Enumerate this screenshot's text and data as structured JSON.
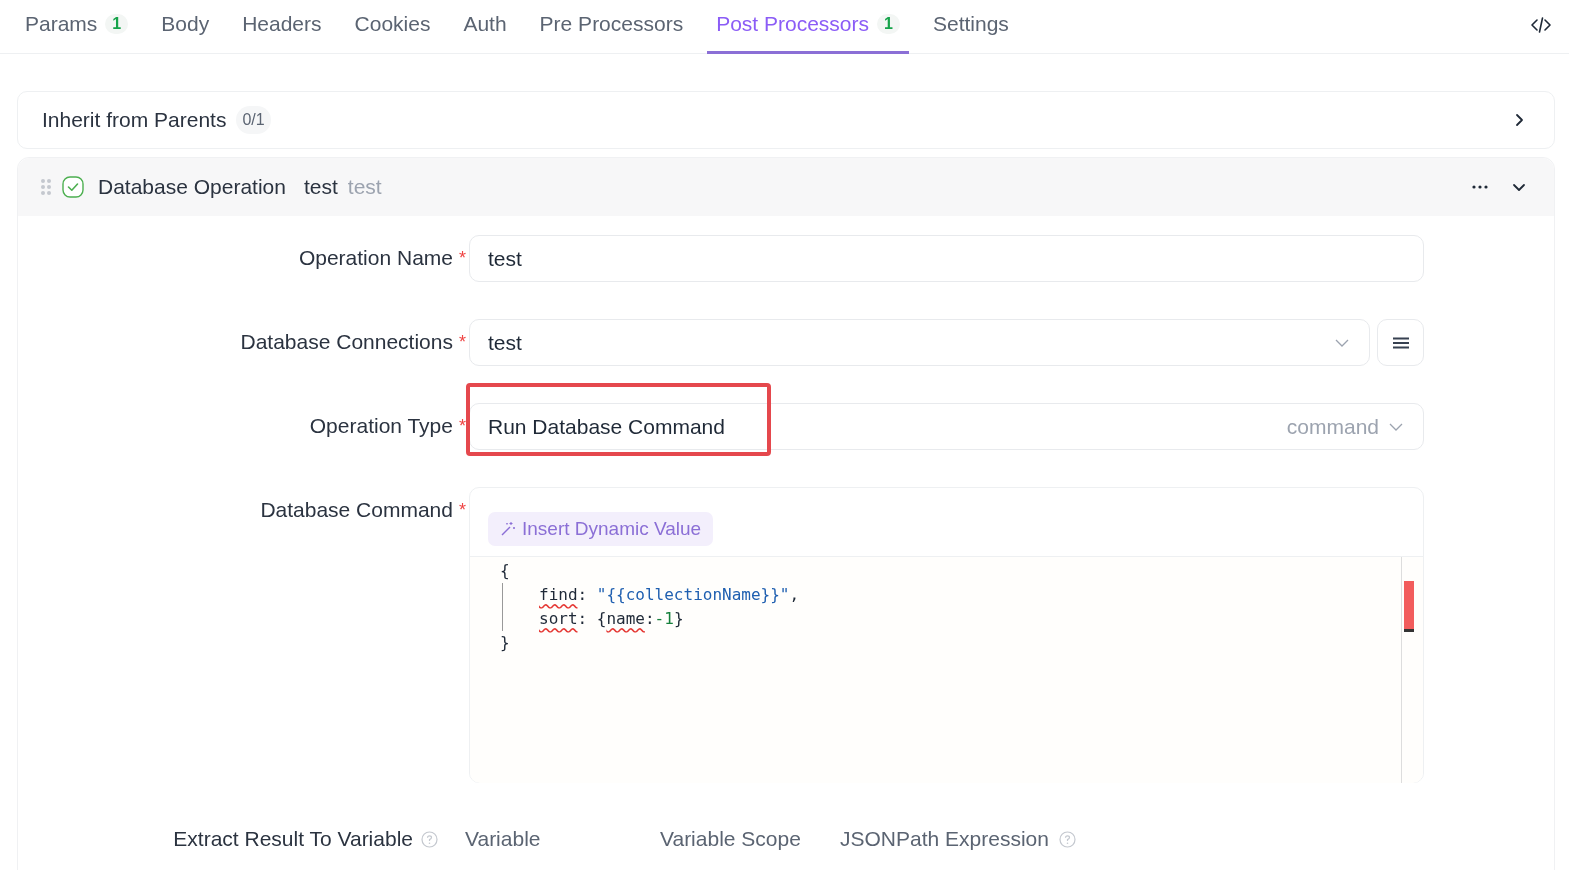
{
  "tabs": [
    {
      "label": "Params",
      "count": "1",
      "selected": false
    },
    {
      "label": "Body",
      "selected": false
    },
    {
      "label": "Headers",
      "selected": false
    },
    {
      "label": "Cookies",
      "selected": false
    },
    {
      "label": "Auth",
      "selected": false
    },
    {
      "label": "Pre Processors",
      "selected": false
    },
    {
      "label": "Post Processors",
      "count": "1",
      "selected": true
    },
    {
      "label": "Settings",
      "selected": false
    }
  ],
  "inherit": {
    "label": "Inherit from Parents",
    "count": "0/1"
  },
  "operation": {
    "enabled": true,
    "type": "Database Operation",
    "name": "test",
    "description": "test",
    "fields": [
      {
        "kind": "text",
        "label": "Operation Name",
        "required_mark": "*",
        "value": "test"
      },
      {
        "kind": "select",
        "label": "Database Connections",
        "required_mark": "*",
        "value": "test"
      },
      {
        "kind": "select",
        "label": "Operation Type",
        "required_mark": "*",
        "value": "Run Database Command",
        "suffix": "command",
        "highlighted": true
      },
      {
        "kind": "code",
        "label": "Database Command",
        "required_mark": "*",
        "insert_button": "Insert Dynamic Value",
        "lines": [
          [
            {
              "kind": "punct",
              "text": "{"
            }
          ],
          [
            {
              "kind": "flagged",
              "text": "find"
            },
            {
              "kind": "punct",
              "text": ": "
            },
            {
              "kind": "string",
              "text": "\"{{collectionName}}\""
            },
            {
              "kind": "punct",
              "text": ","
            }
          ],
          [
            {
              "kind": "flagged",
              "text": "sort"
            },
            {
              "kind": "punct",
              "text": ": {"
            },
            {
              "kind": "flagged",
              "text": "name"
            },
            {
              "kind": "punct",
              "text": ":"
            },
            {
              "kind": "number",
              "text": "-1"
            },
            {
              "kind": "punct",
              "text": "}"
            }
          ],
          [
            {
              "kind": "punct",
              "text": "}"
            }
          ]
        ]
      }
    ],
    "extract": {
      "label": "Extract Result To Variable",
      "columns": [
        {
          "label": "Variable",
          "help": false
        },
        {
          "label": "Variable Scope",
          "help": false
        },
        {
          "label": "JSONPath Expression",
          "help": true
        }
      ]
    }
  }
}
